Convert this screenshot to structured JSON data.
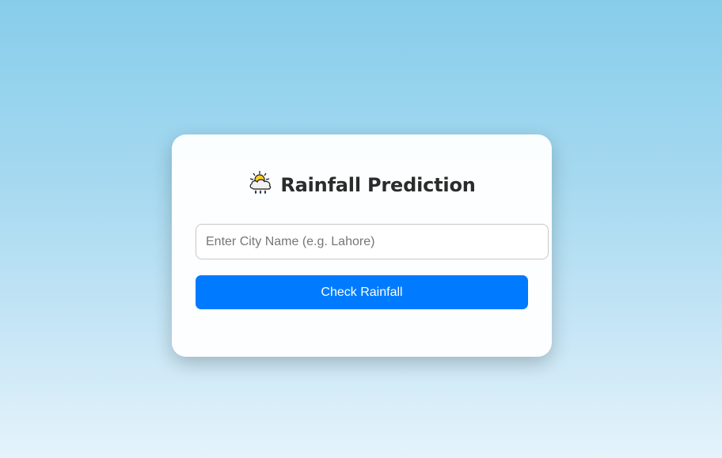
{
  "card": {
    "title": "Rainfall Prediction",
    "icon": "sun-behind-rain-cloud-icon"
  },
  "form": {
    "city_input": {
      "value": "",
      "placeholder": "Enter City Name (e.g. Lahore)"
    },
    "submit_label": "Check Rainfall"
  },
  "colors": {
    "accent": "#007bff",
    "background_top": "#87cdea",
    "background_bottom": "#e6f3fb",
    "title_text": "#2b2b2b"
  }
}
